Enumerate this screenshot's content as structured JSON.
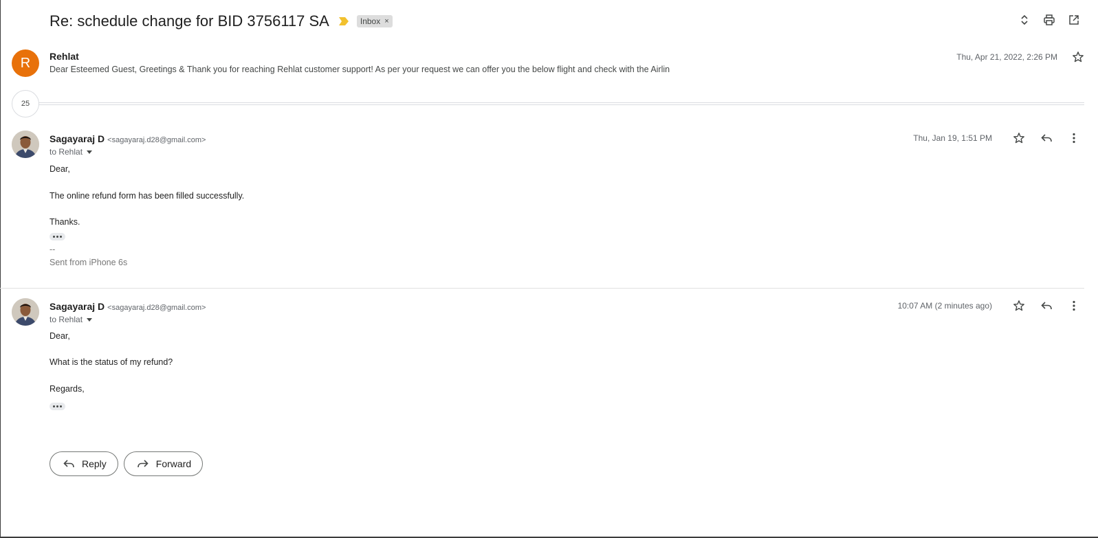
{
  "thread": {
    "subject": "Re: schedule change for BID 3756117 SA",
    "label": "Inbox",
    "label_remove": "×"
  },
  "top_actions": [
    "expand-collapse-icon",
    "print-icon",
    "open-in-new-window-icon"
  ],
  "collapsed_message": {
    "avatar_letter": "R",
    "sender": "Rehlat",
    "snippet": "Dear Esteemed Guest, Greetings & Thank you for reaching Rehlat customer support! As per your request we can offer you the below flight and check with the Airlin",
    "date": "Thu, Apr 21, 2022, 2:26 PM"
  },
  "hidden_count": "25",
  "messages": [
    {
      "sender": "Sagayaraj D",
      "email": "<sagayaraj.d28@gmail.com>",
      "to": "to Rehlat",
      "date": "Thu, Jan 19, 1:51 PM",
      "body": [
        "Dear,",
        "The online refund form has been filled successfully.",
        "Thanks."
      ],
      "signature_sep": "--",
      "signature": "Sent from iPhone 6s"
    },
    {
      "sender": "Sagayaraj D",
      "email": "<sagayaraj.d28@gmail.com>",
      "to": "to Rehlat",
      "date": "10:07 AM (2 minutes ago)",
      "body": [
        "Dear,",
        "What is the status of my refund?",
        "Regards,"
      ]
    }
  ],
  "actions": {
    "reply": "Reply",
    "forward": "Forward"
  },
  "colors": {
    "avatar_orange": "#e8710a",
    "importance_yellow": "#f2c12e",
    "label_bg": "#dddddd"
  }
}
